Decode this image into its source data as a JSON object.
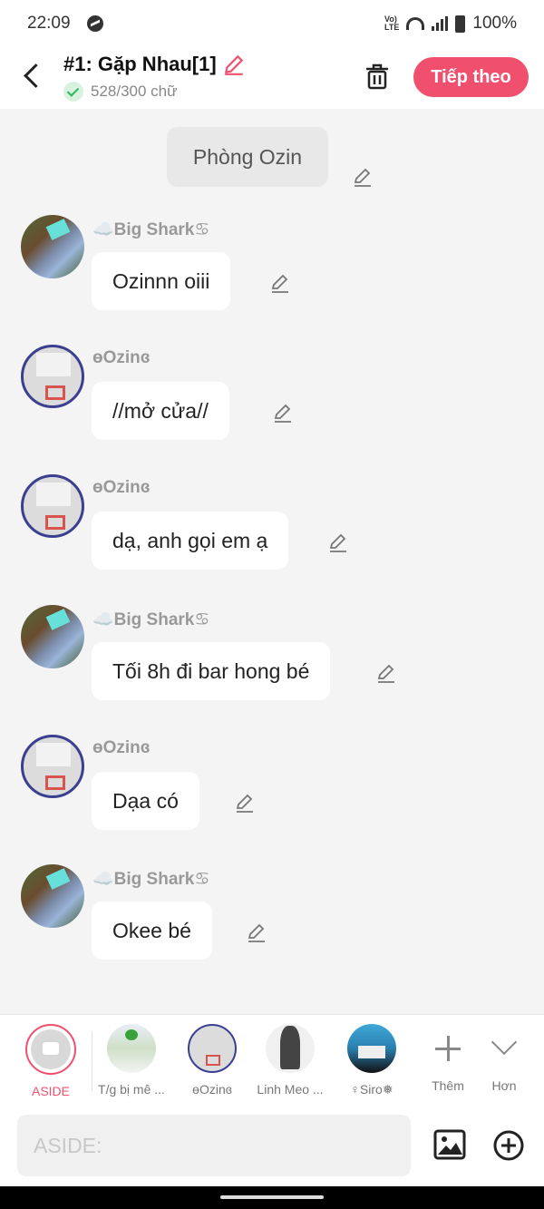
{
  "status_bar": {
    "time": "22:09",
    "network": "Vo) LTE",
    "battery": "100%"
  },
  "header": {
    "title": "#1: Gặp Nhau[1]",
    "word_count": "528/300 chữ",
    "next_label": "Tiếp theo",
    "accent_color": "#f0506e"
  },
  "room": {
    "name": "Phòng Ozin"
  },
  "messages": [
    {
      "sender": "☁️Big Shark♋",
      "text": "Ozinnn oiii",
      "avatar": "shark"
    },
    {
      "sender": "ɵOzinɞ",
      "text": "//mở cửa//",
      "avatar": "ozin"
    },
    {
      "sender": "ɵOzinɞ",
      "text": "dạ, anh gọi em ạ",
      "avatar": "ozin"
    },
    {
      "sender": "☁️Big Shark♋",
      "text": "Tối 8h đi bar hong bé",
      "avatar": "shark"
    },
    {
      "sender": "ɵOzinɞ",
      "text": "Dạa có",
      "avatar": "ozin"
    },
    {
      "sender": "☁️Big Shark♋",
      "text": "Okee bé",
      "avatar": "shark"
    }
  ],
  "characters": [
    {
      "label": "ASIDE",
      "icon": "aside-icon"
    },
    {
      "label": "T/g bị mê ..."
    },
    {
      "label": "ɵOzinɞ"
    },
    {
      "label": "Linh Meo ..."
    },
    {
      "label": "♀Siro❅"
    },
    {
      "label": "Thêm",
      "icon": "plus-icon"
    },
    {
      "label": "Hơn",
      "icon": "chevron-down-icon"
    }
  ],
  "composer": {
    "placeholder": "ASIDE:",
    "value": ""
  }
}
